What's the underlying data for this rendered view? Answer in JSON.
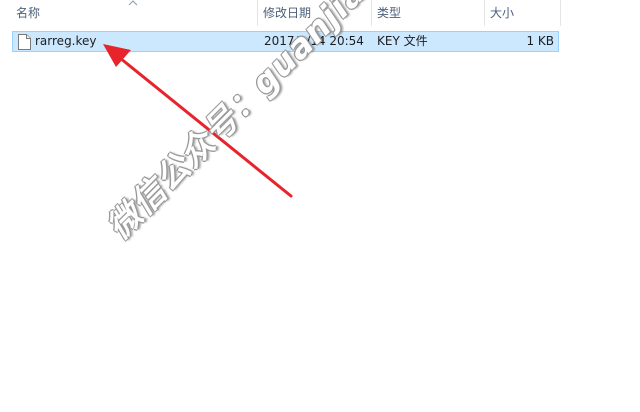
{
  "columns": {
    "name": "名称",
    "modified": "修改日期",
    "type": "类型",
    "size": "大小"
  },
  "files": [
    {
      "name": "rarreg.key",
      "modified": "2017/8/14 20:54",
      "type": "KEY 文件",
      "size": "1 KB",
      "icon": "file-icon",
      "selected": true
    }
  ],
  "annotation": {
    "arrow_color": "#e8232b",
    "watermark": "微信公众号：guanjiaxiao_e"
  },
  "colors": {
    "header_text": "#4c607a",
    "selection_fill": "#cce8ff",
    "selection_border": "#99d1ff"
  }
}
